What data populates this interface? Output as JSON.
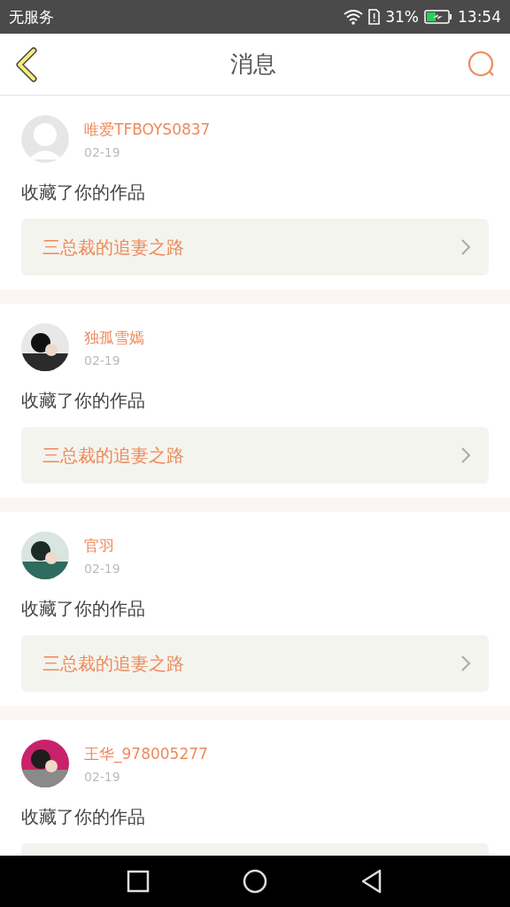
{
  "status_bar": {
    "carrier": "无服务",
    "battery_percent": "31%",
    "time": "13:54"
  },
  "header": {
    "title": "消息"
  },
  "messages": [
    {
      "avatar": {
        "kind": "default"
      },
      "user": "唯爱TFBOYS0837",
      "date": "02-19",
      "action": "收藏了你的作品",
      "work": "三总裁的追妻之路"
    },
    {
      "user": "独孤雪嫣",
      "date": "02-19",
      "action": "收藏了你的作品",
      "work": "三总裁的追妻之路"
    },
    {
      "user": "官羽",
      "date": "02-19",
      "action": "收藏了你的作品",
      "work": "三总裁的追妻之路"
    },
    {
      "user": "王华_978005277",
      "date": "02-19",
      "action": "收藏了你的作品"
    }
  ]
}
